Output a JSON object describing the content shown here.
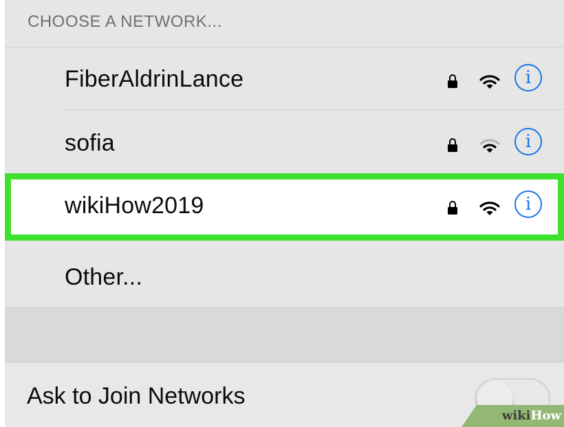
{
  "section": {
    "header": "CHOOSE A NETWORK..."
  },
  "networks": [
    {
      "name": "FiberAldrinLance",
      "secured": true,
      "signal": "full",
      "info_icon": "info-icon"
    },
    {
      "name": "sofia",
      "secured": true,
      "signal": "weak",
      "info_icon": "info-icon"
    },
    {
      "name": "wikiHow2019",
      "secured": true,
      "signal": "full",
      "info_icon": "info-icon",
      "highlighted": true
    }
  ],
  "other": {
    "label": "Other..."
  },
  "ask_to_join": {
    "label": "Ask to Join Networks",
    "enabled": false
  },
  "info_glyph": "i",
  "watermark": {
    "wiki": "wiki",
    "how": "How"
  },
  "colors": {
    "accent": "#1a73e8",
    "highlight": "#3ee22e",
    "background": "#e6e6e6",
    "selected_row": "#ffffff"
  },
  "icons": [
    "lock-icon",
    "wifi-icon",
    "info-icon"
  ]
}
